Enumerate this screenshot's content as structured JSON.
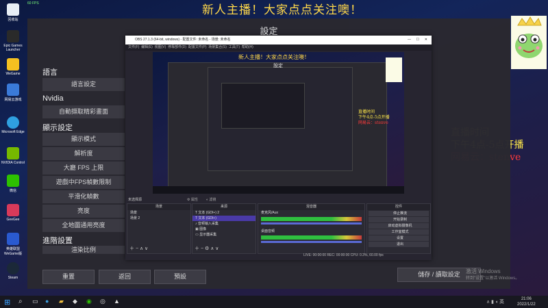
{
  "stream": {
    "fps": "60 FPS",
    "banner": "新人主播！大家点点关注噢！",
    "schedule": [
      "直播时间",
      "下午4点-5点开播"
    ],
    "netease": "网易云：stenve"
  },
  "desktop_icons": [
    "回收站",
    "Epic Games Launcher",
    "WeGame",
    "网易云游戏",
    "Microsoft Edge",
    "NVIDIA Control",
    "微信",
    "GeeGee",
    "英雄联盟 WeGame版",
    "Steam"
  ],
  "settings": {
    "title": "設定",
    "sections": [
      {
        "heading": "語言",
        "items": [
          "語言設定"
        ]
      },
      {
        "heading": "Nvidia",
        "items": [
          "自動擷取精彩畫面"
        ]
      },
      {
        "heading": "顯示設定",
        "items": [
          "顯示模式",
          "解析度",
          "大廳 FPS 上限",
          "遊戲中FPS幀數限制",
          "平滑化幀數",
          "亮度",
          "全地圖通用亮度"
        ]
      },
      {
        "heading": "進階設置",
        "items": [
          "渲染比例"
        ]
      }
    ],
    "buttons": {
      "restore": "重置",
      "back": "返回",
      "default": "預設",
      "save": "儲存 / 讀取設定"
    }
  },
  "obs": {
    "title": "OBS 27.1.3 (64-bit, windows) - 配置文件: 未命名 - 场景: 未命名",
    "menu": [
      "文件(F)",
      "编辑(E)",
      "视图(V)",
      "停靠部件(D)",
      "配置文件(P)",
      "场景集合(S)",
      "工具(T)",
      "帮助(H)"
    ],
    "source_bar": "未选择源",
    "docks": {
      "scenes": {
        "title": "场景",
        "items": [
          "场景",
          "场景 2"
        ]
      },
      "sources": {
        "title": "来源",
        "items": [
          "文本 (GDI+) 2",
          "文本 (GDI+)",
          "音频输入采集",
          "图像",
          "显示器采集"
        ]
      },
      "mixer": {
        "title": "混音器",
        "tracks": [
          {
            "name": "麦克风/Aux",
            "level": "0.0 dB"
          },
          {
            "name": "桌面音频",
            "level": "0.0 dB"
          }
        ]
      },
      "controls": {
        "title": "控件",
        "buttons": [
          "停止推流",
          "开始录制",
          "启动虚拟摄像机",
          "工作室模式",
          "设置",
          "退出"
        ]
      }
    },
    "status": "LIVE: 00:00:00  REC: 00:00:00  CPU: 0.3%, 60.00 fps"
  },
  "watermark": [
    "激活 Windows",
    "转到\"设置\"以激活 Windows。"
  ],
  "taskbar": {
    "time": "21:06",
    "date": "2022/1/22"
  }
}
